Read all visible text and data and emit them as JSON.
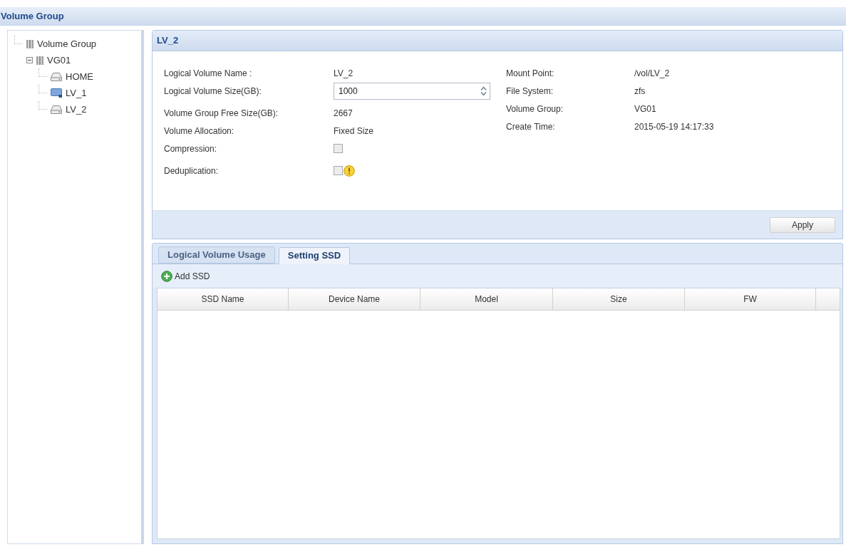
{
  "header": {
    "title": "Volume Group"
  },
  "tree": [
    {
      "label": "Volume Group",
      "kind": "group",
      "children": [
        {
          "label": "VG01",
          "kind": "group",
          "expanded": true,
          "children": [
            {
              "label": "HOME",
              "kind": "drive"
            },
            {
              "label": "LV_1",
              "kind": "monitor"
            },
            {
              "label": "LV_2",
              "kind": "drive"
            }
          ]
        }
      ]
    }
  ],
  "details": {
    "title": "LV_2",
    "left_fields": [
      {
        "label": "Logical Volume Name :",
        "kind": "text",
        "value": "LV_2"
      },
      {
        "label": "Logical Volume Size(GB):",
        "kind": "spinner",
        "value": "1000"
      },
      {
        "label": "Volume Group Free Size(GB):",
        "kind": "text",
        "value": "2667"
      },
      {
        "label": "Volume Allocation:",
        "kind": "text",
        "value": "Fixed Size"
      },
      {
        "label": "Compression:",
        "kind": "checkbox",
        "checked": false
      },
      {
        "label": "Deduplication:",
        "kind": "checkbox",
        "checked": false,
        "warning": true
      }
    ],
    "right_fields": [
      {
        "label": "Mount Point:",
        "value": "/vol/LV_2"
      },
      {
        "label": "File System:",
        "value": "zfs"
      },
      {
        "label": "Volume Group:",
        "value": "VG01"
      },
      {
        "label": "Create Time:",
        "value": "2015-05-19 14:17:33"
      }
    ],
    "apply_button": "Apply"
  },
  "lower_panel": {
    "tabs": [
      {
        "label": "Logical Volume Usage",
        "selected": false
      },
      {
        "label": "Setting SSD",
        "selected": true
      }
    ],
    "toolbar": {
      "add_button": "Add SSD"
    },
    "table": {
      "columns": [
        "SSD Name",
        "Device Name",
        "Model",
        "Size",
        "FW"
      ]
    }
  }
}
